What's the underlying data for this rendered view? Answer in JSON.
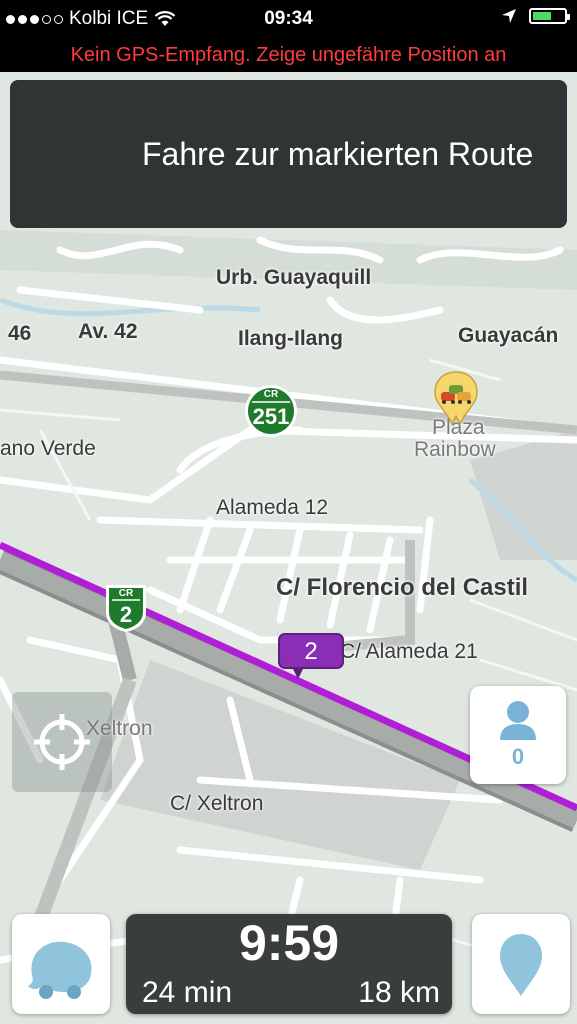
{
  "status_bar": {
    "carrier": "Kolbi ICE",
    "time": "09:34",
    "signal_icon": "signal-dots-icon",
    "wifi_icon": "wifi-icon",
    "location_icon": "location-arrow-icon",
    "battery_icon": "battery-icon",
    "battery_level": 0.5
  },
  "gps_warning": "Kein GPS-Empfang. Zeige ungefähre Position an",
  "instruction": {
    "text": "Fahre zur markierten Route"
  },
  "map": {
    "labels": {
      "urb_guayaquill": "Urb. Guayaquill",
      "num_46": "46",
      "av_42": "Av. 42",
      "ilang": "Ilang-Ilang",
      "guayacan": "Guayacán",
      "plaza": "Plaza",
      "rainbow": "Rainbow",
      "llano_verde": "ano Verde",
      "alameda12": "Alameda 12",
      "florencio": "C/ Florencio del Castil",
      "alameda21": "C/ Alameda 21",
      "xeltron": "Xeltron",
      "c_xeltron": "C/ Xeltron"
    },
    "shields": {
      "cr251": {
        "top": "CR",
        "num": "251"
      },
      "cr2": {
        "top": "CR",
        "num": "2"
      }
    },
    "route_marker": "2",
    "route_color": "#b01fd6"
  },
  "controls": {
    "user_count": "0",
    "eta": "9:59",
    "duration": "24 min",
    "distance": "18 km"
  }
}
